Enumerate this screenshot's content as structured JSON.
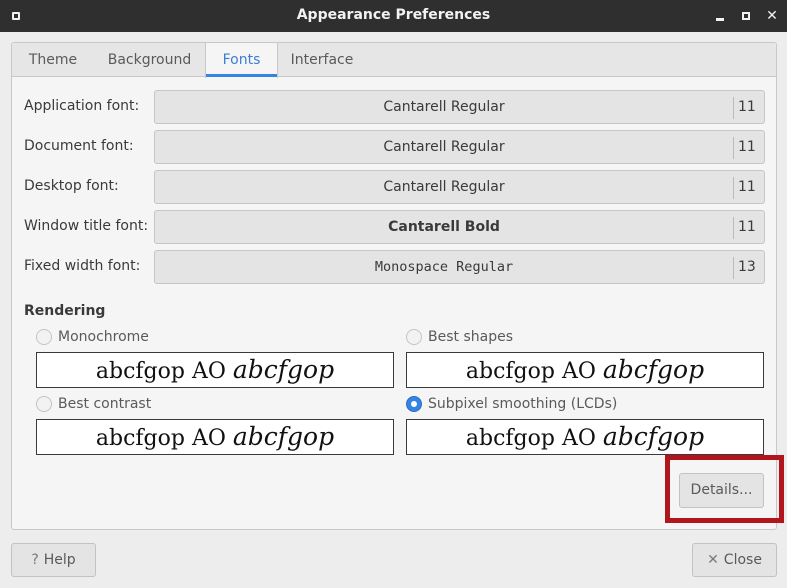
{
  "window": {
    "title": "Appearance Preferences"
  },
  "tabs": [
    {
      "label": "Theme"
    },
    {
      "label": "Background"
    },
    {
      "label": "Fonts"
    },
    {
      "label": "Interface"
    }
  ],
  "active_tab": "Fonts",
  "fonts": [
    {
      "label": "Application font:",
      "name": "Cantarell Regular",
      "size": "11"
    },
    {
      "label": "Document font:",
      "name": "Cantarell Regular",
      "size": "11"
    },
    {
      "label": "Desktop font:",
      "name": "Cantarell Regular",
      "size": "11"
    },
    {
      "label": "Window title font:",
      "name": "Cantarell Bold",
      "size": "11"
    },
    {
      "label": "Fixed width font:",
      "name": "Monospace Regular",
      "size": "13"
    }
  ],
  "rendering": {
    "title": "Rendering",
    "options": [
      {
        "label": "Monochrome",
        "checked": false
      },
      {
        "label": "Best shapes",
        "checked": false
      },
      {
        "label": "Best contrast",
        "checked": false
      },
      {
        "label": "Subpixel smoothing (LCDs)",
        "checked": true
      }
    ],
    "preview_regular": "abcfgop AO",
    "preview_italic": "abcfgop"
  },
  "buttons": {
    "details": "Details...",
    "help": "Help",
    "close": "Close"
  },
  "colors": {
    "accent": "#3584e4",
    "highlight_box": "#b0161b",
    "titlebar": "#2f2f2f"
  }
}
